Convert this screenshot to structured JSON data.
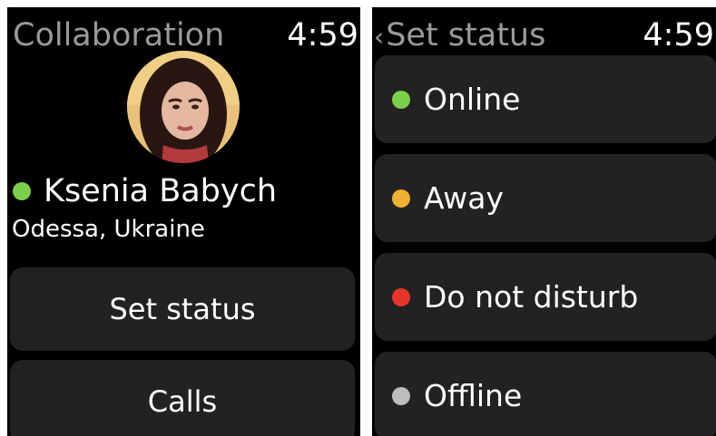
{
  "profile_screen": {
    "title": "Collaboration",
    "time": "4:59",
    "user": {
      "name": "Ksenia Babych",
      "location": "Odessa, Ukraine",
      "status_color": "#7ad04a"
    },
    "buttons": {
      "set_status": "Set status",
      "calls": "Calls"
    }
  },
  "status_screen": {
    "back_icon": "chevron-left-icon",
    "title": "Set status",
    "time": "4:59",
    "options": [
      {
        "label": "Online",
        "color": "#7ad04a"
      },
      {
        "label": "Away",
        "color": "#f0b030"
      },
      {
        "label": "Do not disturb",
        "color": "#e8352c"
      },
      {
        "label": "Offline",
        "color": "#bdbdbd"
      }
    ]
  }
}
